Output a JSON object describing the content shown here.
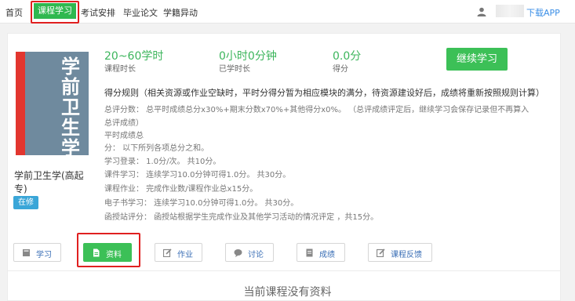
{
  "nav": {
    "items": [
      "首页",
      "课程学习",
      "考试安排",
      "毕业论文",
      "学籍异动"
    ],
    "download": "下载APP"
  },
  "course": {
    "cover_title": "学前卫生学",
    "cover_subtitle": "",
    "name": "学前卫生学(高起专)",
    "status": "在修"
  },
  "stats": [
    {
      "value": "20~60学时",
      "label": "课程时长"
    },
    {
      "value": "0小时0分钟",
      "label": "已学时长"
    },
    {
      "value": "0.0分",
      "label": "得分"
    }
  ],
  "continue_label": "继续学习",
  "rules": {
    "title": "得分规则（相关资源或作业空缺时，平时分得分暂为相应模块的满分，待资源建设好后，成绩将重新按照规则计算）",
    "lines": [
      "总评分数：     总平时成绩总分x30%+期末分数x70%+其他得分x0%。 （总评成绩评定后，继续学习会保存记录但不再算入",
      "总评成绩）",
      "平时成绩总",
      "分：              以下所列各项总分之和。",
      "学习登录：     1.0分/次。 共10分。",
      "课件学习：     连续学习10.0分钟可得1.0分。 共30分。",
      "课程作业：     完成作业数/课程作业总x15分。",
      "电子书学习：  连续学习10.0分钟可得1.0分。 共30分。",
      "函授站评分：  函授站根据学生完成作业及其他学习活动的情况评定 ，共15分。"
    ]
  },
  "tabs": [
    {
      "label": "学习",
      "icon": "book-icon"
    },
    {
      "label": "资料",
      "icon": "document-icon"
    },
    {
      "label": "作业",
      "icon": "edit-icon"
    },
    {
      "label": "讨论",
      "icon": "chat-icon"
    },
    {
      "label": "成绩",
      "icon": "grade-icon"
    },
    {
      "label": "课程反馈",
      "icon": "feedback-icon"
    }
  ],
  "empty_message": "当前课程没有资料",
  "colors": {
    "accent": "#3cc057",
    "link": "#3a8ee6",
    "highlight": "#e02020"
  }
}
